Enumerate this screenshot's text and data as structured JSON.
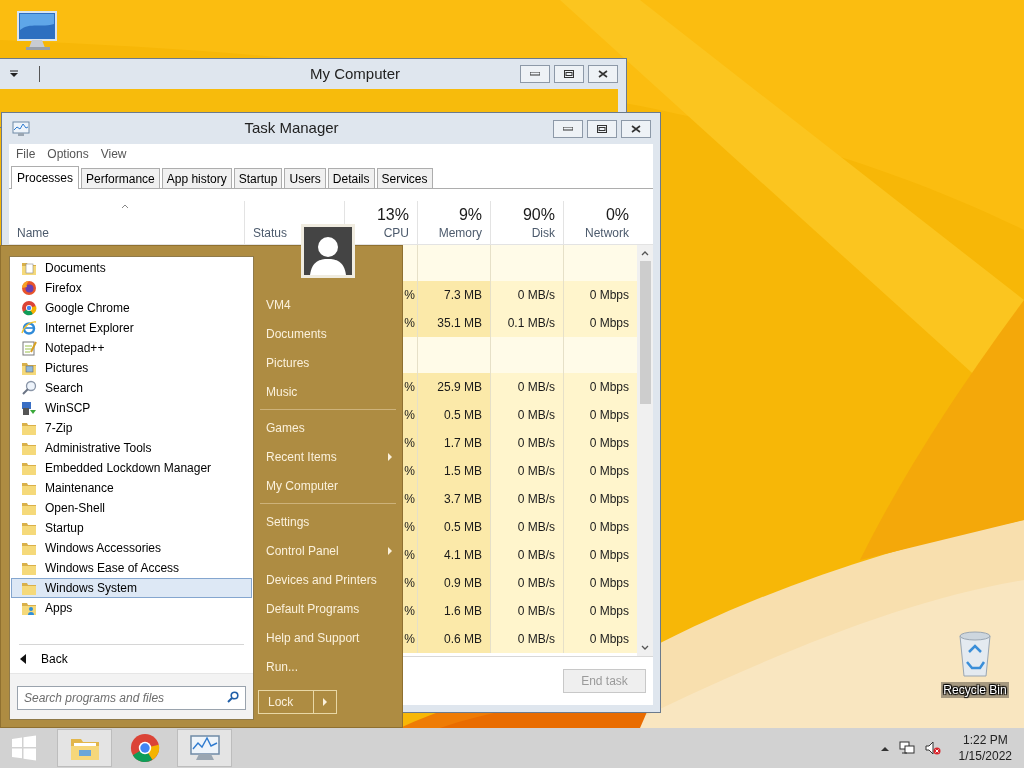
{
  "desktop": {
    "icons": [
      {
        "kind": "computer"
      },
      {
        "kind": "recycle-bin",
        "label": "Recycle Bin"
      }
    ]
  },
  "background_window": {
    "title": "My Computer"
  },
  "task_manager": {
    "title": "Task Manager",
    "menu": [
      "File",
      "Options",
      "View"
    ],
    "tabs": [
      {
        "label": "Processes",
        "selected": true
      },
      {
        "label": "Performance",
        "selected": false
      },
      {
        "label": "App history",
        "selected": false
      },
      {
        "label": "Startup",
        "selected": false
      },
      {
        "label": "Users",
        "selected": false
      },
      {
        "label": "Details",
        "selected": false
      },
      {
        "label": "Services",
        "selected": false
      }
    ],
    "columns": [
      {
        "label": "Name"
      },
      {
        "label": "Status"
      },
      {
        "reading": "13%",
        "label": "CPU"
      },
      {
        "reading": "9%",
        "label": "Memory"
      },
      {
        "reading": "90%",
        "label": "Disk"
      },
      {
        "reading": "0%",
        "label": "Network"
      }
    ],
    "rows": [
      {
        "kind": "group"
      },
      {
        "kind": "process",
        "cpu": "%",
        "memory": "7.3 MB",
        "disk": "0 MB/s",
        "network": "0 Mbps"
      },
      {
        "kind": "process",
        "cpu": "%",
        "memory": "35.1 MB",
        "disk": "0.1 MB/s",
        "network": "0 Mbps"
      },
      {
        "kind": "group"
      },
      {
        "kind": "process",
        "cpu": "%",
        "memory": "25.9 MB",
        "disk": "0 MB/s",
        "network": "0 Mbps"
      },
      {
        "kind": "process",
        "cpu": "%",
        "memory": "0.5 MB",
        "disk": "0 MB/s",
        "network": "0 Mbps"
      },
      {
        "kind": "process",
        "cpu": "%",
        "memory": "1.7 MB",
        "disk": "0 MB/s",
        "network": "0 Mbps"
      },
      {
        "kind": "process",
        "cpu": "%",
        "memory": "1.5 MB",
        "disk": "0 MB/s",
        "network": "0 Mbps"
      },
      {
        "kind": "process",
        "cpu": "%",
        "memory": "3.7 MB",
        "disk": "0 MB/s",
        "network": "0 Mbps"
      },
      {
        "kind": "process",
        "cpu": "%",
        "memory": "0.5 MB",
        "disk": "0 MB/s",
        "network": "0 Mbps"
      },
      {
        "kind": "process",
        "cpu": "%",
        "memory": "4.1 MB",
        "disk": "0 MB/s",
        "network": "0 Mbps"
      },
      {
        "kind": "process",
        "cpu": "%",
        "memory": "0.9 MB",
        "disk": "0 MB/s",
        "network": "0 Mbps"
      },
      {
        "kind": "process",
        "cpu": "%",
        "memory": "1.6 MB",
        "disk": "0 MB/s",
        "network": "0 Mbps"
      },
      {
        "kind": "process",
        "cpu": "%",
        "memory": "0.6 MB",
        "disk": "0 MB/s",
        "network": "0 Mbps"
      }
    ],
    "end_task": {
      "label": "End task",
      "disabled": true
    }
  },
  "start_menu": {
    "programs": [
      {
        "label": "Documents",
        "kind": "documents",
        "selected": false
      },
      {
        "label": "Firefox",
        "kind": "firefox",
        "selected": false
      },
      {
        "label": "Google Chrome",
        "kind": "chrome",
        "selected": false
      },
      {
        "label": "Internet Explorer",
        "kind": "ie",
        "selected": false
      },
      {
        "label": "Notepad++",
        "kind": "notepad",
        "selected": false
      },
      {
        "label": "Pictures",
        "kind": "pictures",
        "selected": false
      },
      {
        "label": "Search",
        "kind": "search",
        "selected": false
      },
      {
        "label": "WinSCP",
        "kind": "winscp",
        "selected": false
      },
      {
        "label": "7-Zip",
        "kind": "folder",
        "selected": false
      },
      {
        "label": "Administrative Tools",
        "kind": "folder",
        "selected": false
      },
      {
        "label": "Embedded Lockdown Manager",
        "kind": "folder",
        "selected": false
      },
      {
        "label": "Maintenance",
        "kind": "folder",
        "selected": false
      },
      {
        "label": "Open-Shell",
        "kind": "folder",
        "selected": false
      },
      {
        "label": "Startup",
        "kind": "folder",
        "selected": false
      },
      {
        "label": "Windows Accessories",
        "kind": "folder",
        "selected": false
      },
      {
        "label": "Windows Ease of Access",
        "kind": "folder",
        "selected": false
      },
      {
        "label": "Windows System",
        "kind": "folder",
        "selected": true
      },
      {
        "label": "Apps",
        "kind": "apps",
        "selected": false
      }
    ],
    "back": "Back",
    "search": {
      "placeholder": "Search programs and files"
    },
    "places": [
      [
        {
          "label": "VM4",
          "submenu": false
        },
        {
          "label": "Documents",
          "submenu": false
        },
        {
          "label": "Pictures",
          "submenu": false
        },
        {
          "label": "Music",
          "submenu": false
        }
      ],
      [
        {
          "label": "Games",
          "submenu": false
        },
        {
          "label": "Recent Items",
          "submenu": true
        },
        {
          "label": "My Computer",
          "submenu": false
        }
      ],
      [
        {
          "label": "Settings",
          "submenu": false
        },
        {
          "label": "Control Panel",
          "submenu": true
        },
        {
          "label": "Devices and Printers",
          "submenu": false
        },
        {
          "label": "Default Programs",
          "submenu": false
        },
        {
          "label": "Help and Support",
          "submenu": false
        },
        {
          "label": "Run...",
          "submenu": false
        }
      ]
    ],
    "lock": "Lock"
  },
  "taskbar": {
    "apps": [
      {
        "kind": "explorer",
        "running": true
      },
      {
        "kind": "chrome",
        "running": false
      },
      {
        "kind": "task-manager",
        "running": true
      }
    ],
    "clock": {
      "time": "1:22 PM",
      "date": "1/15/2022"
    }
  }
}
